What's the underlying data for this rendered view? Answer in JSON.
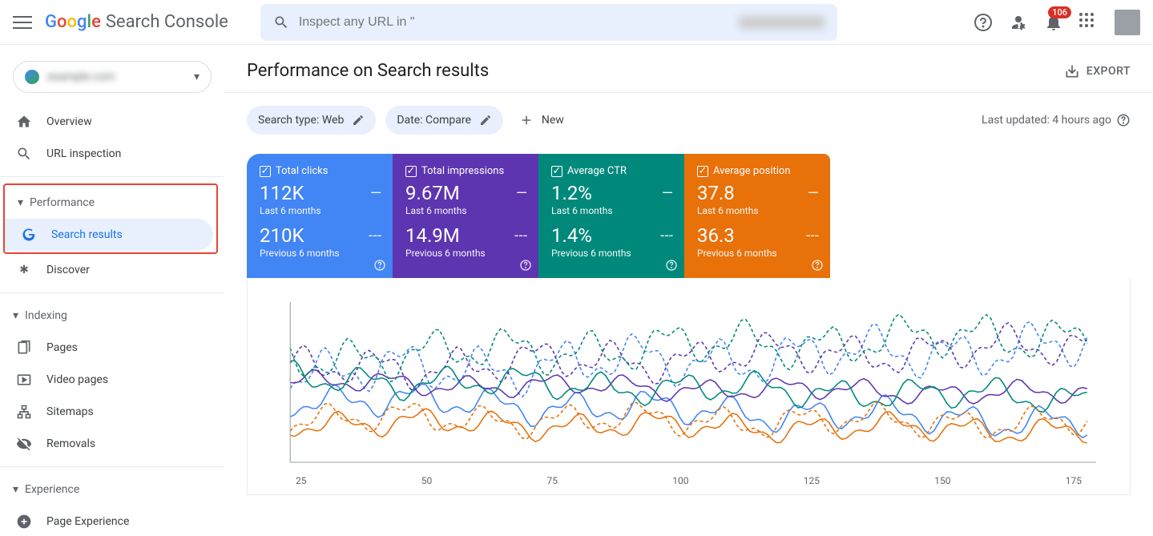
{
  "header": {
    "logo": "Search Console",
    "search_placeholder": "Inspect any URL in \"",
    "property_blur": "example.com",
    "notification_count": "106"
  },
  "sidebar": {
    "property_name": "example.com",
    "items": {
      "overview": "Overview",
      "url_inspection": "URL inspection",
      "performance": "Performance",
      "search_results": "Search results",
      "discover": "Discover",
      "indexing": "Indexing",
      "pages": "Pages",
      "video_pages": "Video pages",
      "sitemaps": "Sitemaps",
      "removals": "Removals",
      "experience": "Experience",
      "page_experience": "Page Experience"
    }
  },
  "main": {
    "title": "Performance on Search results",
    "export": "EXPORT",
    "filters": {
      "search_type": "Search type: Web",
      "date": "Date: Compare",
      "new": "New"
    },
    "last_updated": "Last updated: 4 hours ago",
    "metrics": {
      "clicks": {
        "title": "Total clicks",
        "v1": "112K",
        "l1": "Last 6 months",
        "v2": "210K",
        "l2": "Previous 6 months"
      },
      "impressions": {
        "title": "Total impressions",
        "v1": "9.67M",
        "l1": "Last 6 months",
        "v2": "14.9M",
        "l2": "Previous 6 months"
      },
      "ctr": {
        "title": "Average CTR",
        "v1": "1.2%",
        "l1": "Last 6 months",
        "v2": "1.4%",
        "l2": "Previous 6 months"
      },
      "position": {
        "title": "Average position",
        "v1": "37.8",
        "l1": "Last 6 months",
        "v2": "36.3",
        "l2": "Previous 6 months"
      }
    }
  },
  "chart_data": {
    "type": "line",
    "xlabel": "",
    "ylabel": "",
    "x_ticks": [
      "25",
      "50",
      "75",
      "100",
      "125",
      "150",
      "175"
    ],
    "x_range": [
      0,
      182
    ],
    "series": [
      {
        "name": "Clicks (Last 6 months)",
        "color": "#4285f4",
        "style": "solid"
      },
      {
        "name": "Clicks (Previous 6 months)",
        "color": "#4285f4",
        "style": "dashed"
      },
      {
        "name": "Impressions (Last 6 months)",
        "color": "#5e35b1",
        "style": "solid"
      },
      {
        "name": "Impressions (Previous 6 months)",
        "color": "#5e35b1",
        "style": "dashed"
      },
      {
        "name": "CTR (Last 6 months)",
        "color": "#00897b",
        "style": "solid"
      },
      {
        "name": "CTR (Previous 6 months)",
        "color": "#00897b",
        "style": "dashed"
      },
      {
        "name": "Position (Last 6 months)",
        "color": "#e8710a",
        "style": "solid"
      },
      {
        "name": "Position (Previous 6 months)",
        "color": "#e8710a",
        "style": "dashed"
      }
    ],
    "note": "Exact per-point values not labeled in source; chart shows relative wavy trends for 8 series over ~182 days."
  }
}
